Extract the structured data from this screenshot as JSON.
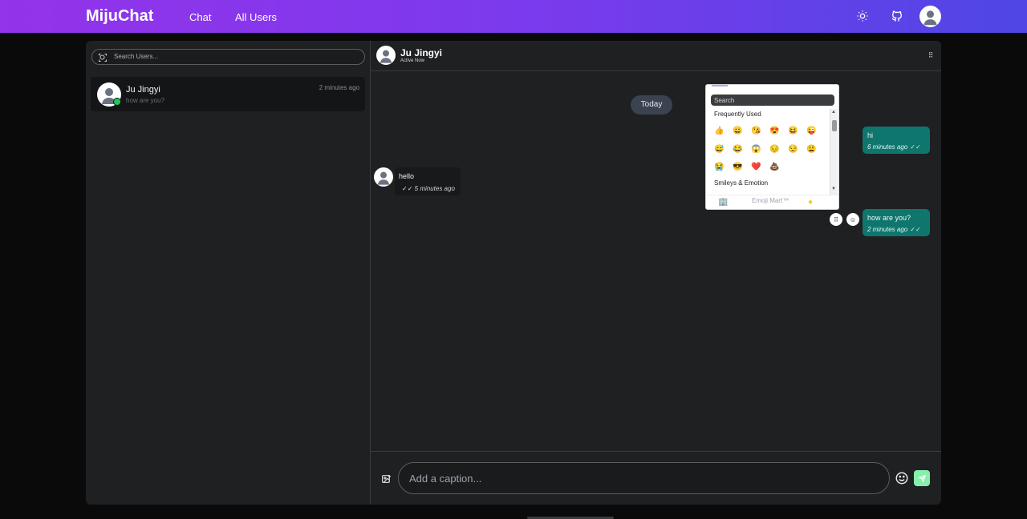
{
  "app": {
    "brand": "MijuChat"
  },
  "nav": {
    "chat": "Chat",
    "all_users": "All Users"
  },
  "header_icons": {
    "theme": "sun-icon",
    "github": "github-icon",
    "avatar": "user-avatar"
  },
  "sidebar": {
    "search_placeholder": "Search Users...",
    "conversations": [
      {
        "name": "Ju Jingyi",
        "last_message": "how are you?",
        "time": "2 minutes ago",
        "online": true
      }
    ]
  },
  "chat": {
    "contact_name": "Ju Jingyi",
    "status": "Active Now",
    "date_divider": "Today",
    "messages": [
      {
        "direction": "out",
        "text": "hi",
        "time": "6 minutes ago"
      },
      {
        "direction": "in",
        "text": "hello",
        "time": "5 minutes ago"
      },
      {
        "direction": "out",
        "text": "how are you?",
        "time": "2 minutes ago"
      }
    ]
  },
  "emoji_picker": {
    "search_placeholder": "Search",
    "categories": [
      "Frequently Used",
      "Smileys & Emotion"
    ],
    "frequently_used": [
      "👍",
      "😀",
      "😘",
      "😍",
      "😆",
      "😜",
      "😅",
      "😂",
      "😱",
      "😔",
      "😒",
      "😩",
      "😭",
      "😎",
      "❤️",
      "💩"
    ],
    "footer_label": "Emoji Mart™"
  },
  "composer": {
    "placeholder": "Add a caption..."
  },
  "colors": {
    "accent_gradient_start": "#9333ea",
    "accent_gradient_end": "#4f46e5",
    "outgoing_bubble": "#0f766e",
    "send_button": "#86efac",
    "online": "#22c55e"
  }
}
